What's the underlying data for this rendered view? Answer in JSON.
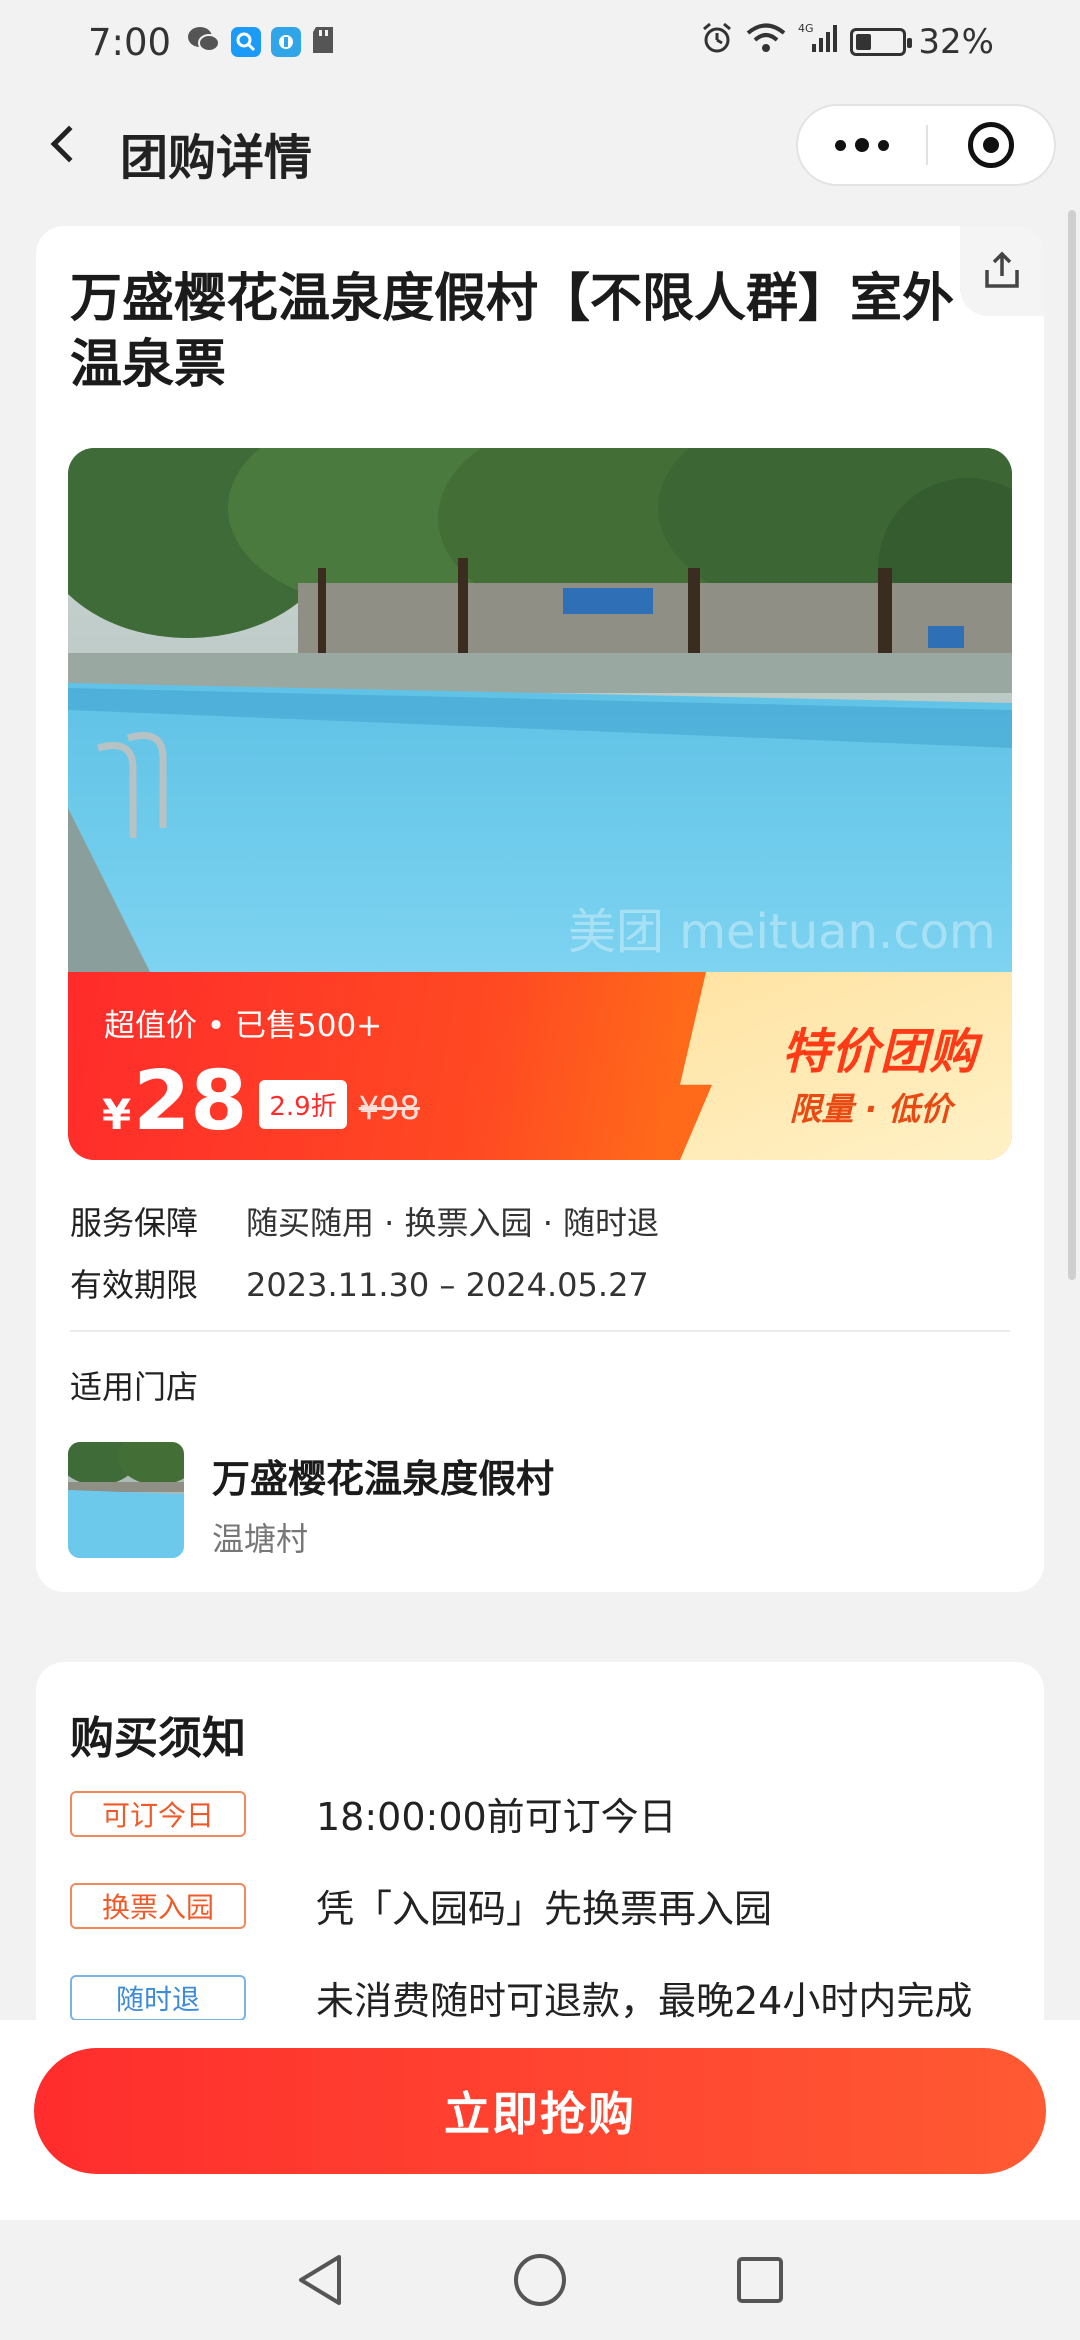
{
  "status_bar": {
    "time": "7:00",
    "battery_percent": "32%",
    "network": "4G"
  },
  "nav": {
    "title": "团购详情"
  },
  "product": {
    "title": "万盛樱花温泉度假村【不限人群】室外温泉票",
    "promo_line": "超值价 • 已售500+",
    "currency": "¥",
    "price": "28",
    "discount": "2.9折",
    "original_price": "¥98",
    "promo_title": "特价团购",
    "promo_sub": "限量 · 低价",
    "watermark": "美团 meituan.com"
  },
  "info": [
    {
      "key": "服务保障",
      "value": "随买随用 · 换票入园 · 随时退"
    },
    {
      "key": "有效期限",
      "value": "2023.11.30 – 2024.05.27"
    }
  ],
  "store": {
    "heading": "适用门店",
    "name": "万盛樱花温泉度假村",
    "area": "温塘村"
  },
  "notice": {
    "title": "购买须知",
    "rows": [
      {
        "tag": "可订今日",
        "text": "18:00:00前可订今日",
        "color": "#f05a28"
      },
      {
        "tag": "换票入园",
        "text": "凭「入园码」先换票再入园",
        "color": "#f05a28"
      },
      {
        "tag": "随时退",
        "text": "未消费随时可退款，最晚24小时内完成",
        "color": "#3e8bd8"
      }
    ]
  },
  "buy_button": {
    "label": "立即抢购"
  },
  "colors": {
    "accent_red": "#ff2d2d",
    "promo_gold": "#ffe3a3"
  },
  "icons": [
    "wechat-icon",
    "search-app-icon",
    "app-icon",
    "sd-card-icon",
    "alarm-icon",
    "wifi-icon",
    "signal-icon",
    "battery-icon",
    "back-icon",
    "more-icon",
    "close-miniprogram-icon",
    "share-icon",
    "back-triangle-icon",
    "home-circle-icon",
    "recents-square-icon"
  ]
}
